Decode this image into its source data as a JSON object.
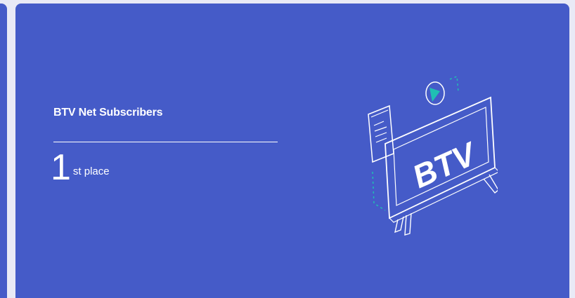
{
  "card": {
    "title": "BTV Net Subscribers",
    "rank_number": "1",
    "rank_suffix": "st place",
    "illustration_text": "BTV",
    "illustration_icon": "tv-play-icon"
  },
  "colors": {
    "background": "#e9eaf6",
    "card": "#455bc8",
    "accent": "#20bfb3",
    "text": "#ffffff"
  }
}
